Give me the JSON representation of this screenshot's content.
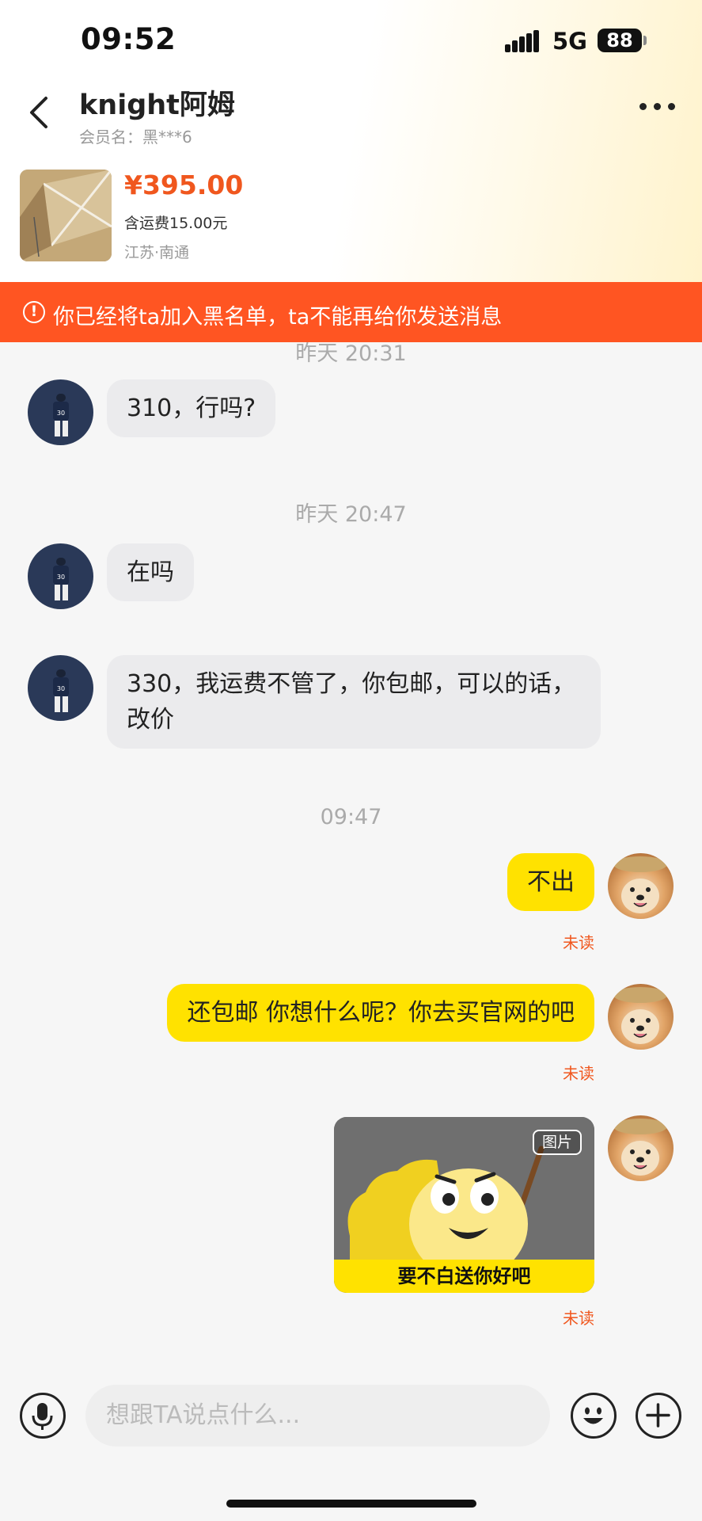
{
  "status_bar": {
    "time": "09:52",
    "network": "5G",
    "battery": "88"
  },
  "header": {
    "title": "knight阿姆",
    "member": "会员名：黑***6"
  },
  "product": {
    "price": "¥395.00",
    "shipping": "含运费15.00元",
    "location": "江苏·南通"
  },
  "banner": {
    "icon": "!",
    "text": "你已经将ta加入黑名单，ta不能再给你发送消息"
  },
  "messages": {
    "ts1": "昨天 20:31",
    "m1": "310，行吗?",
    "ts2": "昨天 20:47",
    "m2": "在吗",
    "m3": "330，我运费不管了，你包邮，可以的话，改价",
    "ts3": "09:47",
    "m4": "不出",
    "m4_status": "未读",
    "m5": "还包邮 你想什么呢？你去买官网的吧",
    "m5_status": "未读",
    "m6_tag": "图片",
    "m6_caption": "要不白送你好吧",
    "m6_status": "未读"
  },
  "input": {
    "placeholder": "想跟TA说点什么..."
  },
  "colors": {
    "accent": "#ff5522",
    "price": "#f0571e",
    "my_bubble": "#ffe200",
    "their_bubble": "#ebebed"
  }
}
